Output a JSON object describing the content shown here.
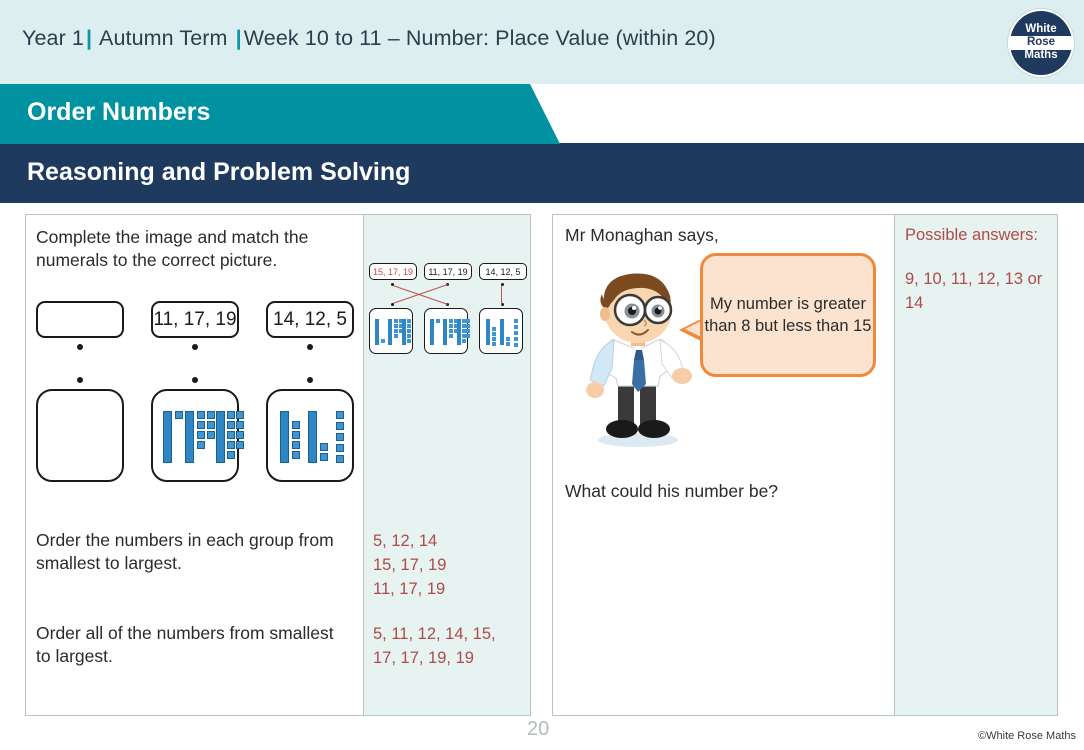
{
  "header": {
    "year": "Year 1",
    "term": "Autumn Term",
    "week": "Week 10 to 11 – Number: Place Value (within 20)",
    "lesson_title": "Order Numbers",
    "section_title": "Reasoning and Problem Solving",
    "logo": {
      "line1": "White",
      "line2": "Rose",
      "line3": "Maths"
    },
    "colors": {
      "teal": "#0092a0",
      "navy": "#1f3a5f",
      "pale": "#ddeef0"
    }
  },
  "question1": {
    "prompt": "Complete the image and match the numerals to the correct picture.",
    "number_boxes": [
      "",
      "11, 17, 19",
      "14, 12, 5"
    ],
    "picture_boxes": [
      {
        "label": "empty",
        "groups": []
      },
      {
        "label": "11, 17, 19",
        "groups": [
          11,
          17,
          19
        ]
      },
      {
        "label": "14, 12, 5",
        "groups": [
          14,
          12,
          5
        ]
      }
    ],
    "sub_prompt_1": "Order the numbers in each group from smallest to largest.",
    "sub_prompt_2": "Order all of the numbers from smallest to largest."
  },
  "answer1": {
    "filled_number_box": "15, 17, 19",
    "number_boxes": [
      "15, 17, 19",
      "11, 17, 19",
      "14, 12, 5"
    ],
    "picture_boxes": [
      {
        "groups": [
          15,
          17,
          19
        ]
      },
      {
        "groups": [
          11,
          17,
          19
        ]
      },
      {
        "groups": [
          14,
          12,
          5
        ]
      }
    ],
    "matches": [
      {
        "from_number": 0,
        "to_picture": 1
      },
      {
        "from_number": 1,
        "to_picture": 0
      },
      {
        "from_number": 2,
        "to_picture": 2
      }
    ],
    "ordered_groups": [
      "5, 12, 14",
      "15, 17, 19",
      "11, 17, 19"
    ],
    "ordered_all": "5, 11, 12, 14, 15, 17, 17, 19, 19"
  },
  "question2": {
    "intro": "Mr Monaghan says,",
    "speech": "My number is greater than 8 but less than 15",
    "question": "What could his number be?"
  },
  "answer2": {
    "heading": "Possible answers:",
    "values": "9, 10, 11, 12, 13 or 14"
  },
  "footer": {
    "page_number": "20",
    "copyright": "©White Rose Maths"
  }
}
